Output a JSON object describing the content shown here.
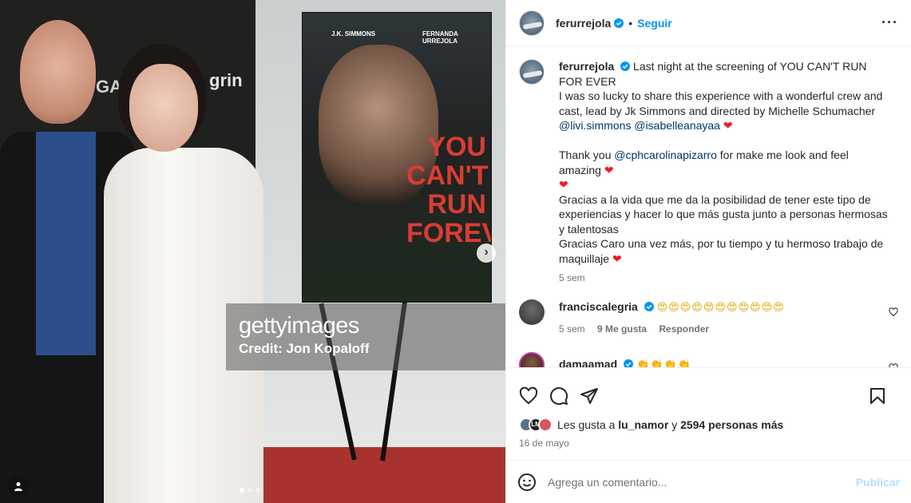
{
  "media": {
    "watermark_logo": "gettyimages",
    "watermark_credit": "Credit: Jon Kopaloff",
    "poster_name1": "J.K. SIMMONS",
    "poster_name2": "FERNANDA URREJOLA",
    "poster_title": "YOU CAN'T RUN FOREVER",
    "backdrop_brand": "grin",
    "carousel_dots": 3,
    "active_dot": 1,
    "next_icon": "chevron-right-icon",
    "tag_icon": "user-tag-icon"
  },
  "header": {
    "username": "ferurrejola",
    "separator": "•",
    "follow_label": "Seguir",
    "more_icon": "more-options-icon"
  },
  "caption": {
    "username": "ferurrejola",
    "text1": "Last night at the screening of YOU CAN'T RUN FOR EVER",
    "text2": "I was so lucky to share this experience with a wonderful crew and cast, lead by Jk Simmons and directed by Michelle Schumacher",
    "mention1": "@livi.simmons",
    "mention2": "@isabelleanayaa",
    "text3_pre": "Thank you",
    "mention3": "@cphcarolinapizarro",
    "text3_post": "for make me look and feel amazing",
    "text4": "Gracias a la vida que me da la posibilidad de tener este tipo de experiencias y hacer lo que más gusta junto a personas hermosas y talentosas",
    "text5": "Gracias Caro una vez más, por tu tiempo y tu hermoso trabajo de maquillaje",
    "time": "5 sem"
  },
  "comments": [
    {
      "username": "franciscalegria",
      "emojis": "😍😍😍😍😍😍😍😍😍😍😍",
      "time": "5 sem",
      "likes": "9 Me gusta",
      "reply": "Responder"
    },
    {
      "username": "damaamad",
      "emojis": "👏👏👏👏"
    }
  ],
  "likes": {
    "prefix": "Les gusta a",
    "user": "lu_namor",
    "conj": "y",
    "others": "2594 personas más",
    "avatar_initials": "LM"
  },
  "date": "16 de mayo",
  "add_comment": {
    "placeholder": "Agrega un comentario...",
    "publish_label": "Publicar"
  },
  "colors": {
    "accent": "#0095f6",
    "mention": "#00376b",
    "heart": "#ed1c24",
    "publish_disabled": "#b2dffc"
  }
}
